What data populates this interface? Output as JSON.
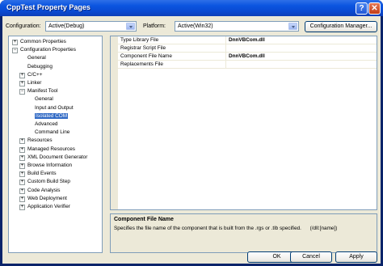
{
  "window": {
    "title": "CppTest Property Pages",
    "help_glyph": "?",
    "close_glyph": "✕"
  },
  "toolbar": {
    "configuration_label": "Configuration:",
    "configuration_value": "Active(Debug)",
    "platform_label": "Platform:",
    "platform_value": "Active(Win32)",
    "config_manager_label": "Configuration Manager..."
  },
  "tree": {
    "items": [
      {
        "label": "Common Properties",
        "exp": "+"
      },
      {
        "label": "Configuration Properties",
        "exp": "−"
      },
      {
        "label": "General"
      },
      {
        "label": "Debugging"
      },
      {
        "label": "C/C++",
        "exp": "+"
      },
      {
        "label": "Linker",
        "exp": "+"
      },
      {
        "label": "Manifest Tool",
        "exp": "−"
      },
      {
        "label": "General"
      },
      {
        "label": "Input and Output"
      },
      {
        "label": "Isolated COM",
        "selected": true
      },
      {
        "label": "Advanced"
      },
      {
        "label": "Command Line"
      },
      {
        "label": "Resources",
        "exp": "+"
      },
      {
        "label": "Managed Resources",
        "exp": "+"
      },
      {
        "label": "XML Document Generator",
        "exp": "+"
      },
      {
        "label": "Browse Information",
        "exp": "+"
      },
      {
        "label": "Build Events",
        "exp": "+"
      },
      {
        "label": "Custom Build Step",
        "exp": "+"
      },
      {
        "label": "Code Analysis",
        "exp": "+"
      },
      {
        "label": "Web Deployment",
        "exp": "+"
      },
      {
        "label": "Application Verifier",
        "exp": "+"
      }
    ]
  },
  "grid": {
    "rows": [
      {
        "name": "Type Library File",
        "value": "DnnVBCom.dll"
      },
      {
        "name": "Registrar Script File",
        "value": ""
      },
      {
        "name": "Component File Name",
        "value": "DnnVBCom.dll"
      },
      {
        "name": "Replacements File",
        "value": ""
      }
    ]
  },
  "description": {
    "title": "Component File Name",
    "text": "Specifies the file name of the component that is built from the .rgs or .tlb specified.      (/dll:[name])"
  },
  "buttons": {
    "ok": "OK",
    "cancel": "Cancel",
    "apply": "Apply"
  }
}
